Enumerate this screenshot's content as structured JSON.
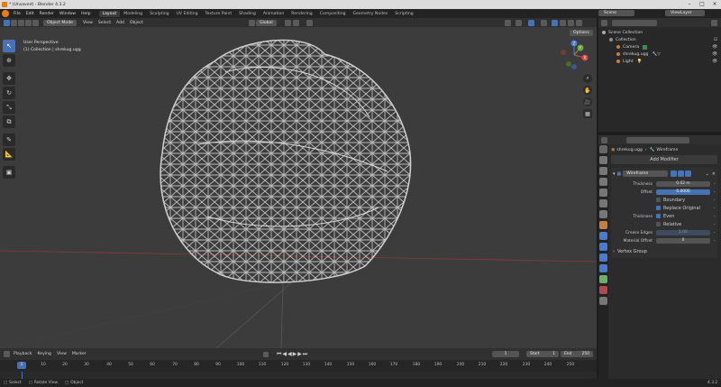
{
  "window": {
    "title": "* (Unsaved) - Blender 4.3.2"
  },
  "menu": [
    "File",
    "Edit",
    "Render",
    "Window",
    "Help"
  ],
  "workspaces": [
    {
      "label": "Layout",
      "active": true
    },
    {
      "label": "Modeling",
      "active": false
    },
    {
      "label": "Sculpting",
      "active": false
    },
    {
      "label": "UV Editing",
      "active": false
    },
    {
      "label": "Texture Paint",
      "active": false
    },
    {
      "label": "Shading",
      "active": false
    },
    {
      "label": "Animation",
      "active": false
    },
    {
      "label": "Rendering",
      "active": false
    },
    {
      "label": "Compositing",
      "active": false
    },
    {
      "label": "Geometry Nodes",
      "active": false
    },
    {
      "label": "Scripting",
      "active": false
    }
  ],
  "top_right": {
    "scene": "Scene",
    "view_layer": "ViewLayer"
  },
  "viewport_header": {
    "mode": "Object Mode",
    "menus": [
      "View",
      "Select",
      "Add",
      "Object"
    ],
    "transform": "Global",
    "options": "Options"
  },
  "viewport": {
    "perspective": "User Perspective",
    "collection": "(1) Collection | shrekug.ugg"
  },
  "gizmo": {
    "x": "X",
    "y": "Y",
    "z": "Z"
  },
  "timeline": {
    "menus": [
      "Playback",
      "Keying",
      "View",
      "Marker"
    ],
    "current_frame": "1",
    "start_label": "Start",
    "start": "1",
    "end_label": "End",
    "end": "250",
    "ruler_ticks": [
      "10",
      "20",
      "30",
      "40",
      "50",
      "60",
      "70",
      "80",
      "90",
      "100",
      "110",
      "120",
      "130",
      "140",
      "150",
      "160",
      "170",
      "180",
      "190",
      "200",
      "210",
      "220",
      "230",
      "240",
      "250"
    ],
    "ruler_current": "1"
  },
  "statusbar": {
    "select": "Select",
    "rotate": "Rotate View",
    "object": "Object",
    "version": "4.3.2"
  },
  "outliner": {
    "root": "Scene Collection",
    "items": [
      {
        "label": "Collection",
        "level": 1,
        "color": "#8f8f8f"
      },
      {
        "label": "Camera",
        "level": 2,
        "color": "#c6803b"
      },
      {
        "label": "shrekug.ugg",
        "level": 2,
        "color": "#c6803b"
      },
      {
        "label": "Light",
        "level": 2,
        "color": "#c6803b"
      }
    ]
  },
  "properties": {
    "object": "shrekug.ugg",
    "modifier_title": "Wireframe",
    "add_modifier": "Add Modifier",
    "modifier_name": "Wireframe",
    "thickness_label": "Thickness",
    "thickness": "0.02 m",
    "offset_label": "Offset",
    "offset": "0.0000",
    "boundary": "Boundary",
    "replace_original": "Replace Original",
    "thickness2_label": "Thickness",
    "even": "Even",
    "relative": "Relative",
    "crease_label": "Crease Edges",
    "crease": "1.00",
    "material_offset_label": "Material Offset",
    "material_offset": "0",
    "vertex_group": "Vertex Group"
  }
}
